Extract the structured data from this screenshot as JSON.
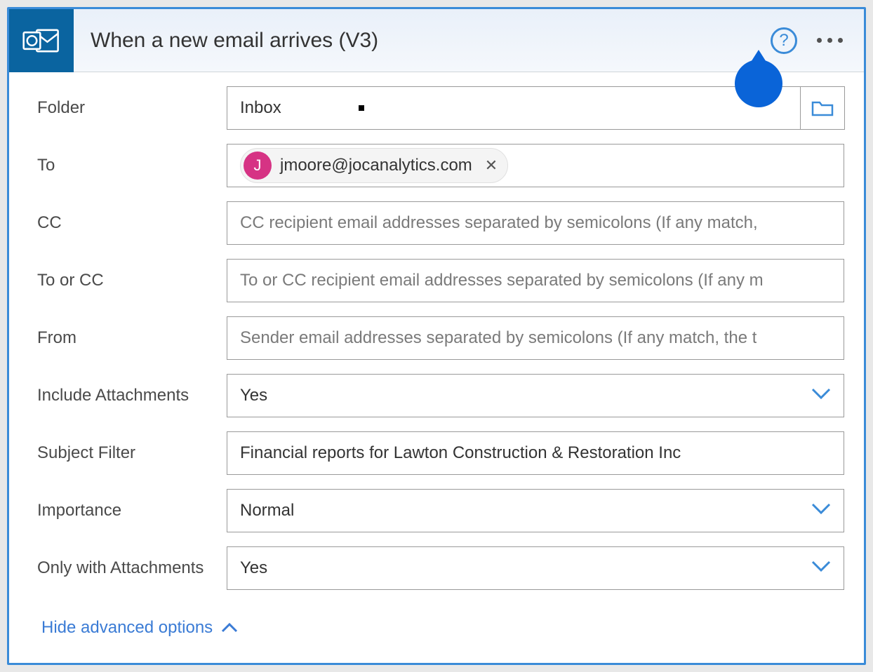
{
  "header": {
    "title": "When a new email arrives (V3)",
    "icon": "outlook-icon"
  },
  "fields": {
    "folder": {
      "label": "Folder",
      "value": "Inbox"
    },
    "to": {
      "label": "To",
      "chip": {
        "initial": "J",
        "email": "jmoore@jocanalytics.com"
      }
    },
    "cc": {
      "label": "CC",
      "placeholder": "CC recipient email addresses separated by semicolons (If any match,"
    },
    "tocc": {
      "label": "To or CC",
      "placeholder": "To or CC recipient email addresses separated by semicolons (If any m"
    },
    "from": {
      "label": "From",
      "placeholder": "Sender email addresses separated by semicolons (If any match, the t"
    },
    "include_attachments": {
      "label": "Include Attachments",
      "value": "Yes"
    },
    "subject_filter": {
      "label": "Subject Filter",
      "value": "Financial reports for Lawton Construction & Restoration Inc"
    },
    "importance": {
      "label": "Importance",
      "value": "Normal"
    },
    "only_attachments": {
      "label": "Only with Attachments",
      "value": "Yes"
    }
  },
  "footer": {
    "toggle": "Hide advanced options"
  }
}
